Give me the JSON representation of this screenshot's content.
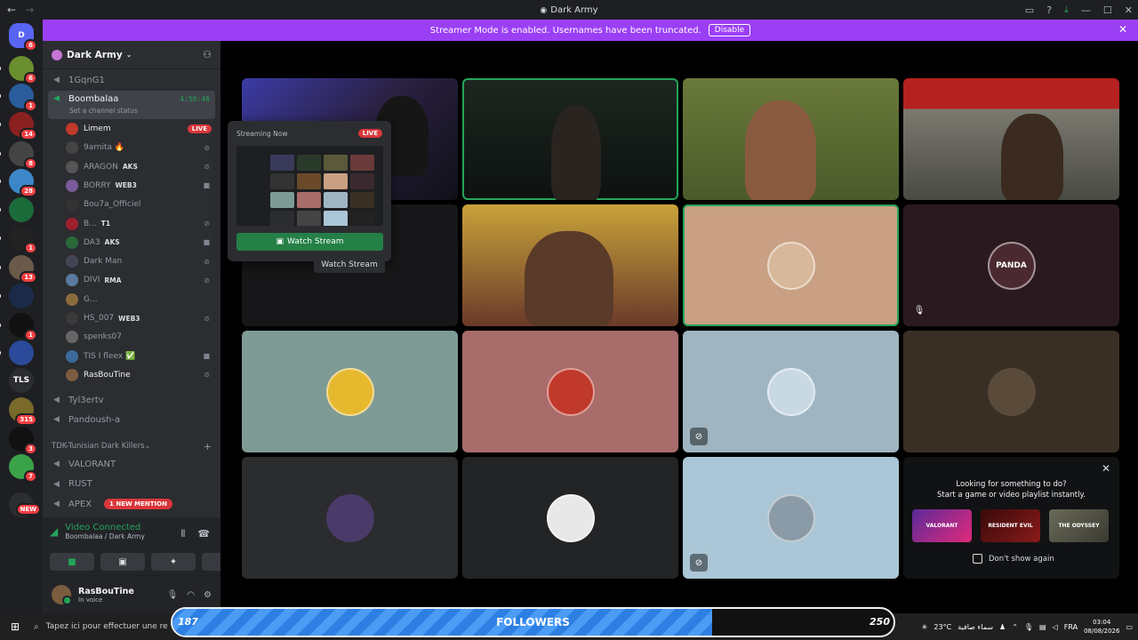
{
  "window": {
    "title": "Dark Army",
    "back": "←",
    "forward": "→"
  },
  "banner": {
    "text": "Streamer Mode is enabled. Usernames have been truncated.",
    "button": "Disable"
  },
  "rail": [
    {
      "badge": "6",
      "color": "#5865f2",
      "label": "D"
    },
    {
      "badge": "6",
      "color": "#6a8f2e",
      "label": ""
    },
    {
      "badge": "1",
      "color": "#2a5b9a",
      "label": ""
    },
    {
      "badge": "14",
      "color": "#8a2020",
      "label": ""
    },
    {
      "badge": "8",
      "color": "#444",
      "label": ""
    },
    {
      "badge": "28",
      "color": "#3d87c9",
      "label": ""
    },
    {
      "badge": "",
      "color": "#1c6b3a",
      "label": ""
    },
    {
      "badge": "1",
      "color": "#222",
      "label": ""
    },
    {
      "badge": "13",
      "color": "#6b5a4a",
      "label": ""
    },
    {
      "badge": "",
      "color": "#1c2a4a",
      "label": ""
    },
    {
      "badge": "1",
      "color": "#111",
      "label": ""
    },
    {
      "badge": "",
      "color": "#2b4a9a",
      "label": ""
    },
    {
      "badge": "",
      "color": "#2b2d31",
      "label": "TLS"
    },
    {
      "badge": "315",
      "color": "#7a6a2a",
      "label": ""
    },
    {
      "badge": "3",
      "color": "#111",
      "label": ""
    },
    {
      "badge": "7",
      "color": "#3aa34a",
      "label": ""
    },
    {
      "badge": "NEW",
      "color": "#2b2d31",
      "label": ""
    }
  ],
  "sidebar": {
    "server_name": "Dark Army",
    "channels_top": [
      "1GqnG1"
    ],
    "active_channel": {
      "name": "Boombalaa",
      "timer": "4:56:46",
      "status": "Set a channel status"
    },
    "members": [
      {
        "name": "Limem",
        "tag": "",
        "live": "LIVE",
        "color": "#c0392b"
      },
      {
        "name": "9arnita 🔥",
        "tag": "",
        "color": "#444"
      },
      {
        "name": "ARAGON",
        "tag": "AKS",
        "color": "#555"
      },
      {
        "name": "BORRY",
        "tag": "WEB3",
        "color": "#7a5a9a"
      },
      {
        "name": "Bou7a_Officiel",
        "tag": "",
        "color": "#333"
      },
      {
        "name": "B...",
        "tag": "T1",
        "color": "#a02030"
      },
      {
        "name": "DA3",
        "tag": "AKS",
        "color": "#2a6a3a"
      },
      {
        "name": "Dark Man",
        "tag": "",
        "color": "#445"
      },
      {
        "name": "DIVI",
        "tag": "RMA",
        "color": "#5a7aa0"
      },
      {
        "name": "G...",
        "tag": "",
        "color": "#8a6a3a"
      },
      {
        "name": "HS_007",
        "tag": "WEB3",
        "color": "#3a3a3a"
      },
      {
        "name": "spenks07",
        "tag": "",
        "color": "#666"
      },
      {
        "name": "TIS I fleex ✅",
        "tag": "",
        "color": "#3a6a9a"
      },
      {
        "name": "RasBouTine",
        "tag": "",
        "color": "#7a5c3e"
      }
    ],
    "channels_bottom": [
      "Tyl3ertv",
      "Pandoush-a"
    ],
    "category": "TDK-Tunisian Dark Killers",
    "text_channels": [
      {
        "name": "VALORANT",
        "mention": ""
      },
      {
        "name": "RUST",
        "mention": ""
      },
      {
        "name": "APEX",
        "mention": "1 NEW MENTION"
      }
    ]
  },
  "voice_panel": {
    "title": "Video Connected",
    "subtitle": "Boombalaa / Dark Army"
  },
  "user_panel": {
    "username": "RasBouTine",
    "status": "In voice"
  },
  "popup": {
    "header": "Streaming Now",
    "live": "LIVE",
    "button": "Watch Stream"
  },
  "tooltip": "Watch Stream",
  "activity": {
    "line1": "Looking for something to do?",
    "line2": "Start a game or video playlist instantly.",
    "games": [
      "VALORANT",
      "RESIDENT EVIL",
      "THE ODYSSEY"
    ],
    "checkbox": "Don't show again"
  },
  "followers": {
    "current": "187",
    "label": "FOLLOWERS",
    "goal": "250",
    "progress": 0.748
  },
  "taskbar": {
    "search": "Tapez ici pour effectuer une re",
    "weather": "23°C",
    "weather_text": "سماء صافية",
    "lang": "FRA",
    "time": "03:04",
    "date": "08/08/2026"
  },
  "colors": {
    "accent": "#5865f2",
    "banner": "#9b3ff5",
    "green": "#23a559",
    "live": "#da373c"
  }
}
